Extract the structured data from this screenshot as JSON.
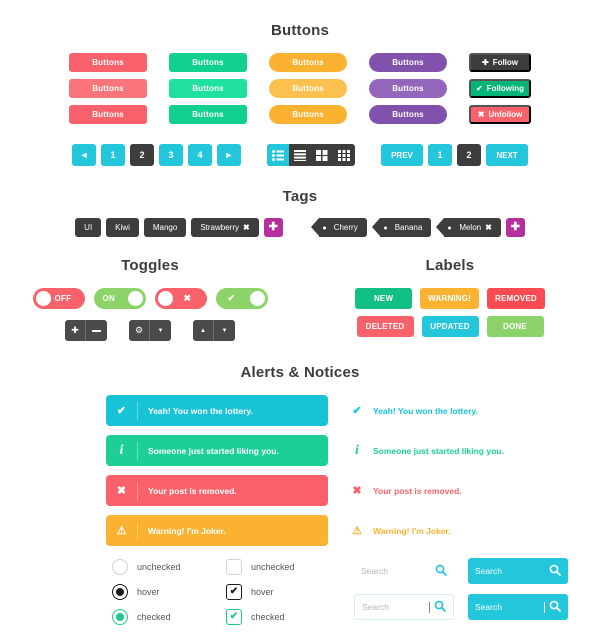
{
  "sections": {
    "buttons": "Buttons",
    "tags": "Tags",
    "toggles": "Toggles",
    "labels": "Labels",
    "alerts": "Alerts & Notices"
  },
  "buttons": {
    "label": "Buttons",
    "columns": [
      {
        "shape": "square",
        "colors": [
          "#f9626a",
          "#f9747b",
          "#f9626a"
        ]
      },
      {
        "shape": "square",
        "colors": [
          "#12d18e",
          "#1fe09d",
          "#12d18e"
        ]
      },
      {
        "shape": "pill",
        "colors": [
          "#fbb231",
          "#fcc04f",
          "#fbb231"
        ]
      },
      {
        "shape": "pill",
        "colors": [
          "#8052ab",
          "#9366bb",
          "#8052ab"
        ]
      }
    ],
    "social": [
      {
        "label": "Follow",
        "icon": "plus-icon",
        "glyph": "✚",
        "bg": "#3d3d3d"
      },
      {
        "label": "Following",
        "icon": "check-icon",
        "glyph": "✔",
        "bg": "#00b575"
      },
      {
        "label": "Unfollow",
        "icon": "close-icon",
        "glyph": "✖",
        "bg": "#f9626a"
      }
    ]
  },
  "pagination": {
    "arrows": [
      {
        "label": "◄",
        "name": "prev-arrow",
        "state": "normal"
      },
      {
        "label": "1",
        "name": "page-1",
        "state": "normal"
      },
      {
        "label": "2",
        "name": "page-2",
        "state": "active"
      },
      {
        "label": "3",
        "name": "page-3",
        "state": "normal"
      },
      {
        "label": "4",
        "name": "page-4",
        "state": "normal"
      },
      {
        "label": "►",
        "name": "next-arrow",
        "state": "normal"
      }
    ],
    "views": [
      {
        "name": "list-view-icon",
        "state": "active"
      },
      {
        "name": "lines-view-icon",
        "state": "normal"
      },
      {
        "name": "grid-view-icon",
        "state": "normal"
      },
      {
        "name": "dense-grid-view-icon",
        "state": "normal"
      }
    ],
    "prevnext": [
      {
        "label": "PREV",
        "name": "prev-button",
        "state": "normal",
        "wide": true
      },
      {
        "label": "1",
        "name": "page-1-alt",
        "state": "normal",
        "wide": false
      },
      {
        "label": "2",
        "name": "page-2-alt",
        "state": "active",
        "wide": false
      },
      {
        "label": "NEXT",
        "name": "next-button",
        "state": "normal",
        "wide": true
      }
    ],
    "accent": "#24c6dc",
    "active_bg": "#3d3d3d"
  },
  "tags": {
    "left": [
      {
        "label": "UI",
        "removable": false
      },
      {
        "label": "Kiwi",
        "removable": false
      },
      {
        "label": "Mango",
        "removable": false
      },
      {
        "label": "Strawberry",
        "removable": true
      }
    ],
    "right": [
      {
        "label": "Cherry",
        "removable": false
      },
      {
        "label": "Banana",
        "removable": false
      },
      {
        "label": "Melon",
        "removable": true
      }
    ],
    "add_label": "✚",
    "remove_glyph": "✖",
    "add_color": "#b5309d",
    "tag_color": "#3d3d3d"
  },
  "toggles": {
    "switches": [
      {
        "name": "toggle-off",
        "label": "OFF",
        "bg": "#f9626a",
        "knob": "left",
        "icon": ""
      },
      {
        "name": "toggle-on",
        "label": "ON",
        "bg": "#8cd469",
        "knob": "right",
        "icon": ""
      },
      {
        "name": "toggle-off-x",
        "label": "",
        "bg": "#f9626a",
        "knob": "left",
        "icon": "✖"
      },
      {
        "name": "toggle-on-check",
        "label": "",
        "bg": "#8cd469",
        "knob": "right",
        "icon": "✔"
      }
    ],
    "steppers": [
      {
        "name": "plus-minus-stepper",
        "buttons": [
          {
            "glyph": "✚",
            "icon": "plus-icon"
          },
          {
            "glyph": "➖",
            "icon": "minus-icon"
          }
        ]
      },
      {
        "name": "settings-dropdown",
        "buttons": [
          {
            "glyph": "⚙",
            "icon": "gear-icon"
          },
          {
            "glyph": "▼",
            "icon": "chevron-down-icon"
          }
        ]
      },
      {
        "name": "up-down-stepper",
        "buttons": [
          {
            "glyph": "▲",
            "icon": "chevron-up-icon"
          },
          {
            "glyph": "▼",
            "icon": "chevron-down-icon"
          }
        ]
      }
    ]
  },
  "labels": {
    "rows": [
      [
        {
          "text": "NEW",
          "bg": "#12c086"
        },
        {
          "text": "WARNING!",
          "bg": "#fbb231"
        },
        {
          "text": "REMOVED",
          "bg": "#fa4b52"
        }
      ],
      [
        {
          "text": "DELETED",
          "bg": "#f9626a"
        },
        {
          "text": "UPDATED",
          "bg": "#24c6dc"
        },
        {
          "text": "DONE",
          "bg": "#8cd469"
        }
      ]
    ]
  },
  "alerts": [
    {
      "text": "Yeah! You won the lottery.",
      "icon": "check-icon",
      "glyph": "✔",
      "bg": "#18c3d8",
      "color": "#18c3d8"
    },
    {
      "text": "Someone just started liking you.",
      "icon": "info-icon",
      "glyph": "ℹ",
      "bg": "#1ccf96",
      "color": "#1ccf96"
    },
    {
      "text": "Your post is removed.",
      "icon": "close-icon",
      "glyph": "✖",
      "bg": "#f9626a",
      "color": "#f9626a"
    },
    {
      "text": "Warning! I'm Joker.",
      "icon": "warning-icon",
      "glyph": "⚠",
      "bg": "#fbb231",
      "color": "#fbb231"
    }
  ],
  "controls": {
    "radios": [
      {
        "label": "unchecked",
        "state": "unchecked"
      },
      {
        "label": "hover",
        "state": "hover"
      },
      {
        "label": "checked",
        "state": "checked"
      }
    ],
    "checkboxes": [
      {
        "label": "unchecked",
        "state": "unchecked"
      },
      {
        "label": "hover",
        "state": "hover"
      },
      {
        "label": "checked",
        "state": "checked"
      }
    ],
    "check_glyph": "✔"
  },
  "search": {
    "placeholder": "Search",
    "icon": "search-icon",
    "glyph": "⌕",
    "fields": [
      {
        "name": "search-plain",
        "style": "plain",
        "caret": false
      },
      {
        "name": "search-bordered",
        "style": "bord",
        "caret": true
      },
      {
        "name": "search-filled",
        "style": "fill",
        "caret": false
      },
      {
        "name": "search-filled-focus",
        "style": "fill",
        "caret": true
      }
    ]
  }
}
